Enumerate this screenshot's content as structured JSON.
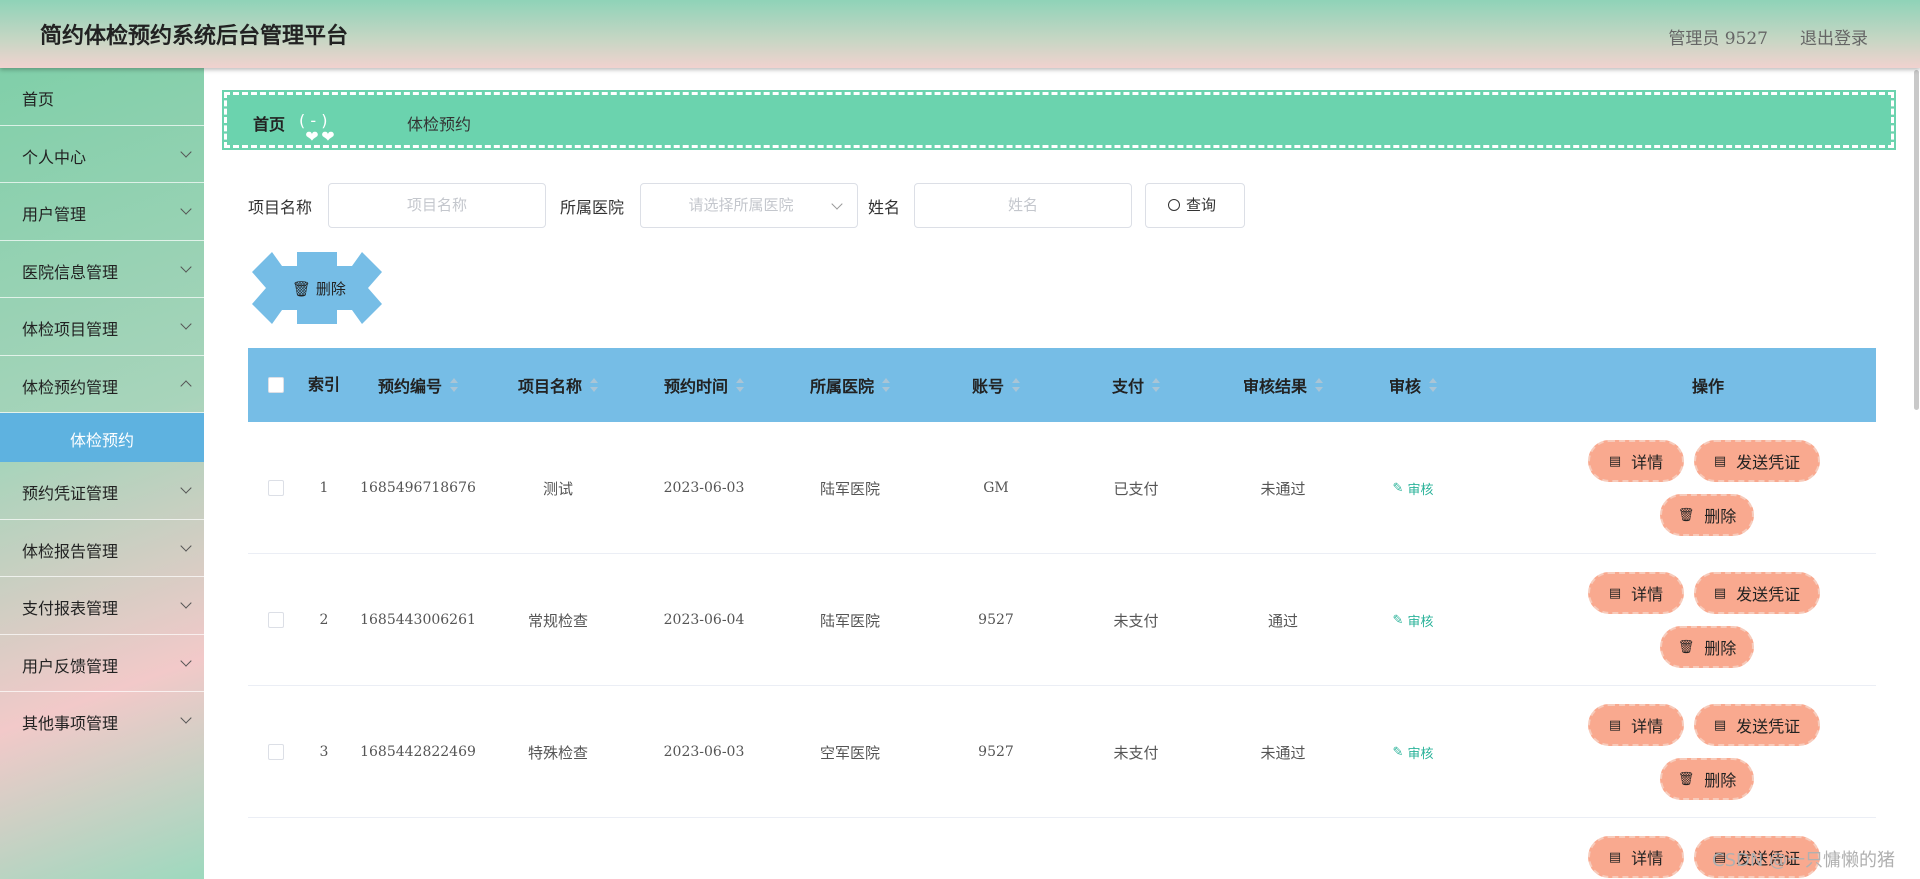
{
  "header": {
    "title": "简约体检预约系统后台管理平台",
    "admin": "管理员 9527",
    "logout": "退出登录"
  },
  "sidebar": {
    "items": [
      {
        "label": "首页"
      },
      {
        "label": "个人中心"
      },
      {
        "label": "用户管理"
      },
      {
        "label": "医院信息管理"
      },
      {
        "label": "体检项目管理"
      },
      {
        "label": "体检预约管理"
      },
      {
        "label": "体检预约"
      },
      {
        "label": "预约凭证管理"
      },
      {
        "label": "体检报告管理"
      },
      {
        "label": "支付报表管理"
      },
      {
        "label": "用户反馈管理"
      },
      {
        "label": "其他事项管理"
      }
    ]
  },
  "breadcrumb": {
    "home": "首页",
    "current": "体检预约"
  },
  "search": {
    "project_label": "项目名称",
    "project_placeholder": "项目名称",
    "hospital_label": "所属医院",
    "hospital_placeholder": "请选择所属医院",
    "name_label": "姓名",
    "name_placeholder": "姓名",
    "query": "查询"
  },
  "toolbar": {
    "delete": "删除"
  },
  "table": {
    "headers": {
      "index": "索引",
      "no": "预约编号",
      "project": "项目名称",
      "time": "预约时间",
      "hospital": "所属医院",
      "account": "账号",
      "pay": "支付",
      "result": "审核结果",
      "review": "审核",
      "ops": "操作"
    },
    "rows": [
      {
        "index": "1",
        "no": "1685496718676",
        "project": "测试",
        "time": "2023-06-03",
        "hospital": "陆军医院",
        "account": "GM",
        "pay": "已支付",
        "result": "未通过",
        "review": "审核"
      },
      {
        "index": "2",
        "no": "1685443006261",
        "project": "常规检查",
        "time": "2023-06-04",
        "hospital": "陆军医院",
        "account": "9527",
        "pay": "未支付",
        "result": "通过",
        "review": "审核"
      },
      {
        "index": "3",
        "no": "1685442822469",
        "project": "特殊检查",
        "time": "2023-06-03",
        "hospital": "空军医院",
        "account": "9527",
        "pay": "未支付",
        "result": "未通过",
        "review": "审核"
      }
    ],
    "actions": {
      "detail": "详情",
      "send": "发送凭证",
      "delete": "删除"
    }
  },
  "watermark": "CSDN @一只慵懒的猪"
}
